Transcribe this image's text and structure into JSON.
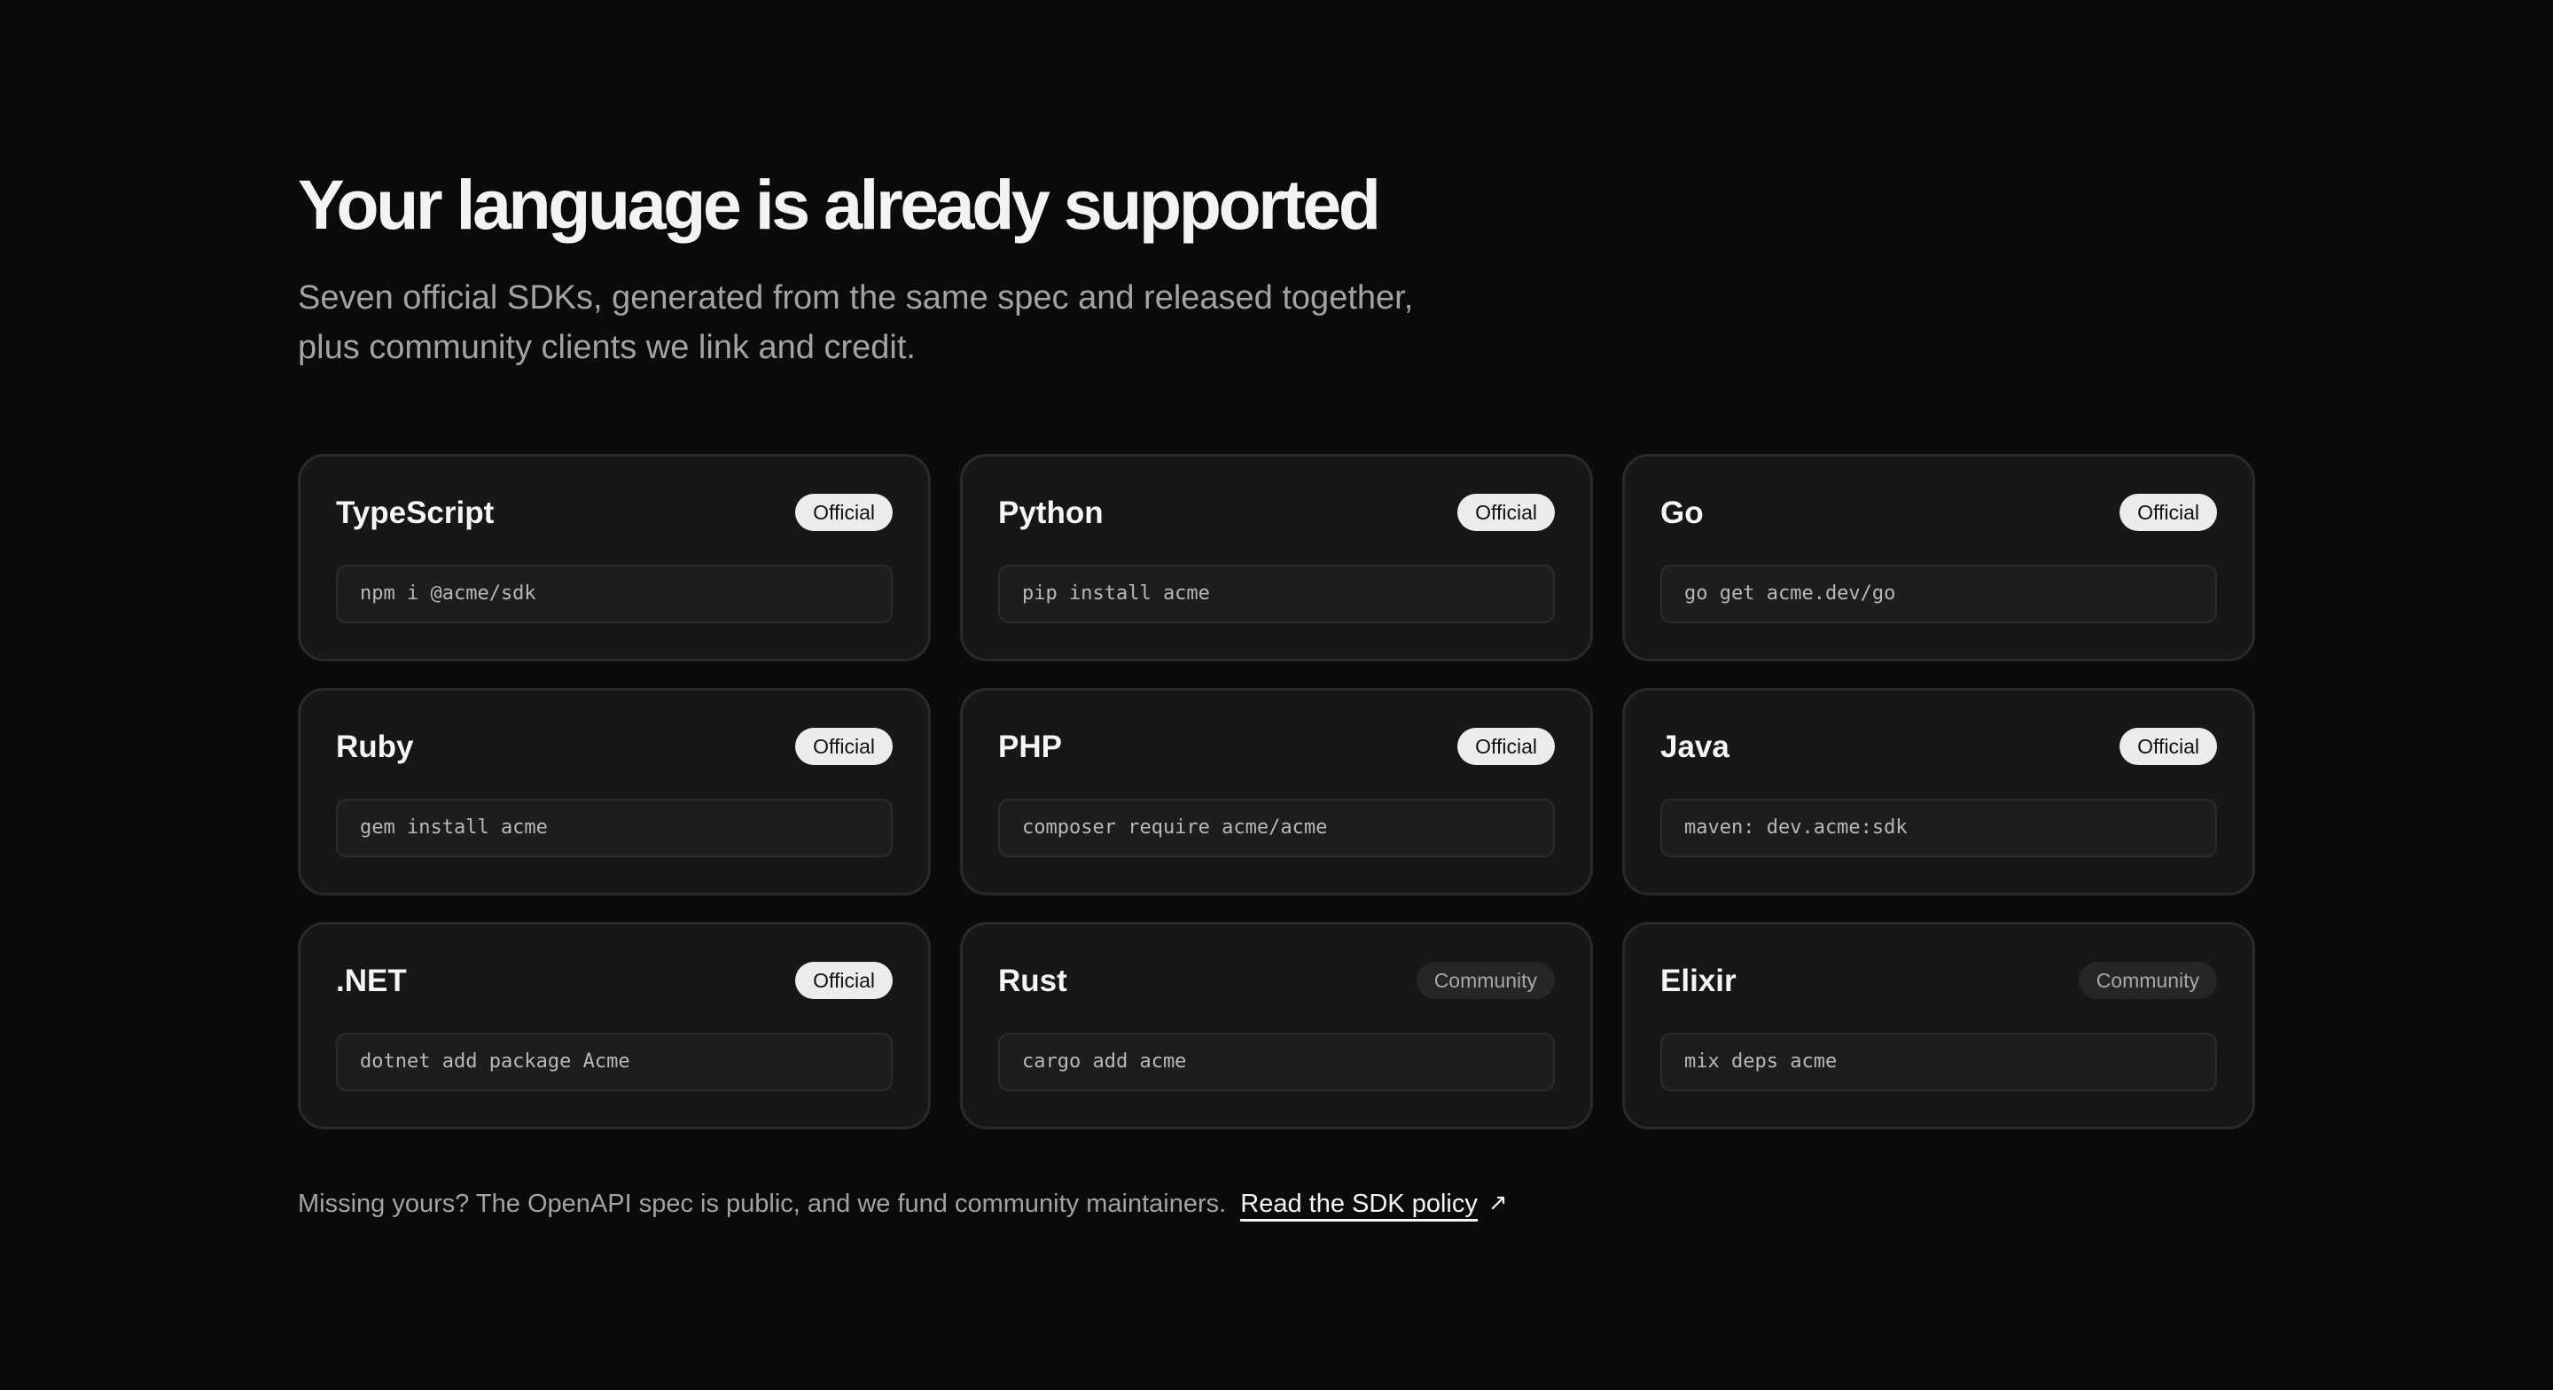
{
  "header": {
    "title": "Your language is already supported",
    "subtitle_line1": "Seven official SDKs, generated from the same spec and released together,",
    "subtitle_line2": "plus community clients we link and credit."
  },
  "sdks": [
    {
      "name": "TypeScript",
      "badge": "Official",
      "command": "npm i @acme/sdk"
    },
    {
      "name": "Python",
      "badge": "Official",
      "command": "pip install acme"
    },
    {
      "name": "Go",
      "badge": "Official",
      "command": "go get acme.dev/go"
    },
    {
      "name": "Ruby",
      "badge": "Official",
      "command": "gem install acme"
    },
    {
      "name": "PHP",
      "badge": "Official",
      "command": "composer require acme/acme"
    },
    {
      "name": "Java",
      "badge": "Official",
      "command": "maven: dev.acme:sdk"
    },
    {
      "name": ".NET",
      "badge": "Official",
      "command": "dotnet add package Acme"
    },
    {
      "name": "Rust",
      "badge": "Community",
      "command": "cargo add acme"
    },
    {
      "name": "Elixir",
      "badge": "Community",
      "command": "mix deps acme"
    }
  ],
  "footer": {
    "text": "Missing yours? The OpenAPI spec is public, and we fund community maintainers.",
    "link_label": "Read the SDK policy",
    "link_icon": "arrow-up-right-icon"
  },
  "colors": {
    "background": "#0b0b0b",
    "card": "#171717",
    "official_badge": "#ececec",
    "community_badge": "#262626"
  }
}
